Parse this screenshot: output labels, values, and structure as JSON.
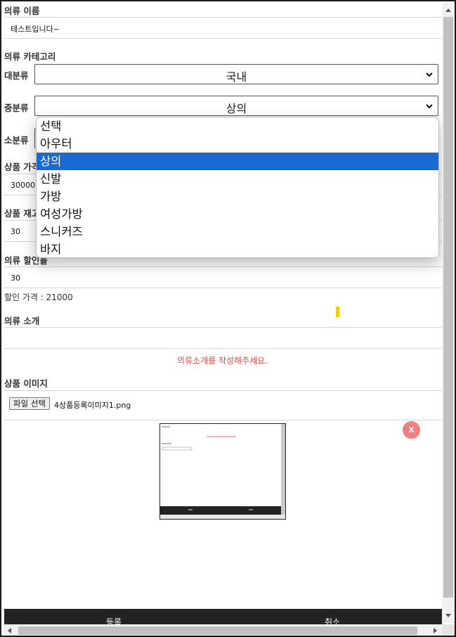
{
  "form": {
    "name_label": "의류 이름",
    "name_value": "테스트입니다~",
    "category_label": "의류 카테고리",
    "major_label": "대분류",
    "major_value": "국내",
    "mid_label": "중분류",
    "mid_value": "상의",
    "minor_label": "소분류",
    "price_label": "상품 가격",
    "price_value": "30000",
    "stock_label": "상품 재고",
    "stock_value": "30",
    "discount_label": "의류 할인율",
    "discount_value": "30",
    "discount_price_text": "할인 가격 : 21000",
    "intro_label": "의류 소개",
    "intro_error": "의류소개를 작성해주세요.",
    "image_label": "상품 이미지",
    "file_button": "파일 선택",
    "file_name": "4상품등록이미지1.png",
    "delete_button": "X",
    "submit_button": "등록",
    "cancel_button": "취소"
  },
  "dropdown": {
    "options": [
      "선택",
      "아우터",
      "상의",
      "신발",
      "가방",
      "여성가방",
      "스니커즈",
      "바지"
    ],
    "selected_index": 2
  },
  "colors": {
    "accent": "#1a6ad3",
    "error": "#d9534f",
    "delete": "#ef7f7f",
    "bottom_bar": "#232323"
  },
  "icons": {
    "select_chevron": "chevron-down-icon",
    "scroll_up": "arrow-up-icon",
    "scroll_down": "arrow-down-icon",
    "scroll_left": "arrow-left-icon",
    "scroll_right": "arrow-right-icon"
  }
}
